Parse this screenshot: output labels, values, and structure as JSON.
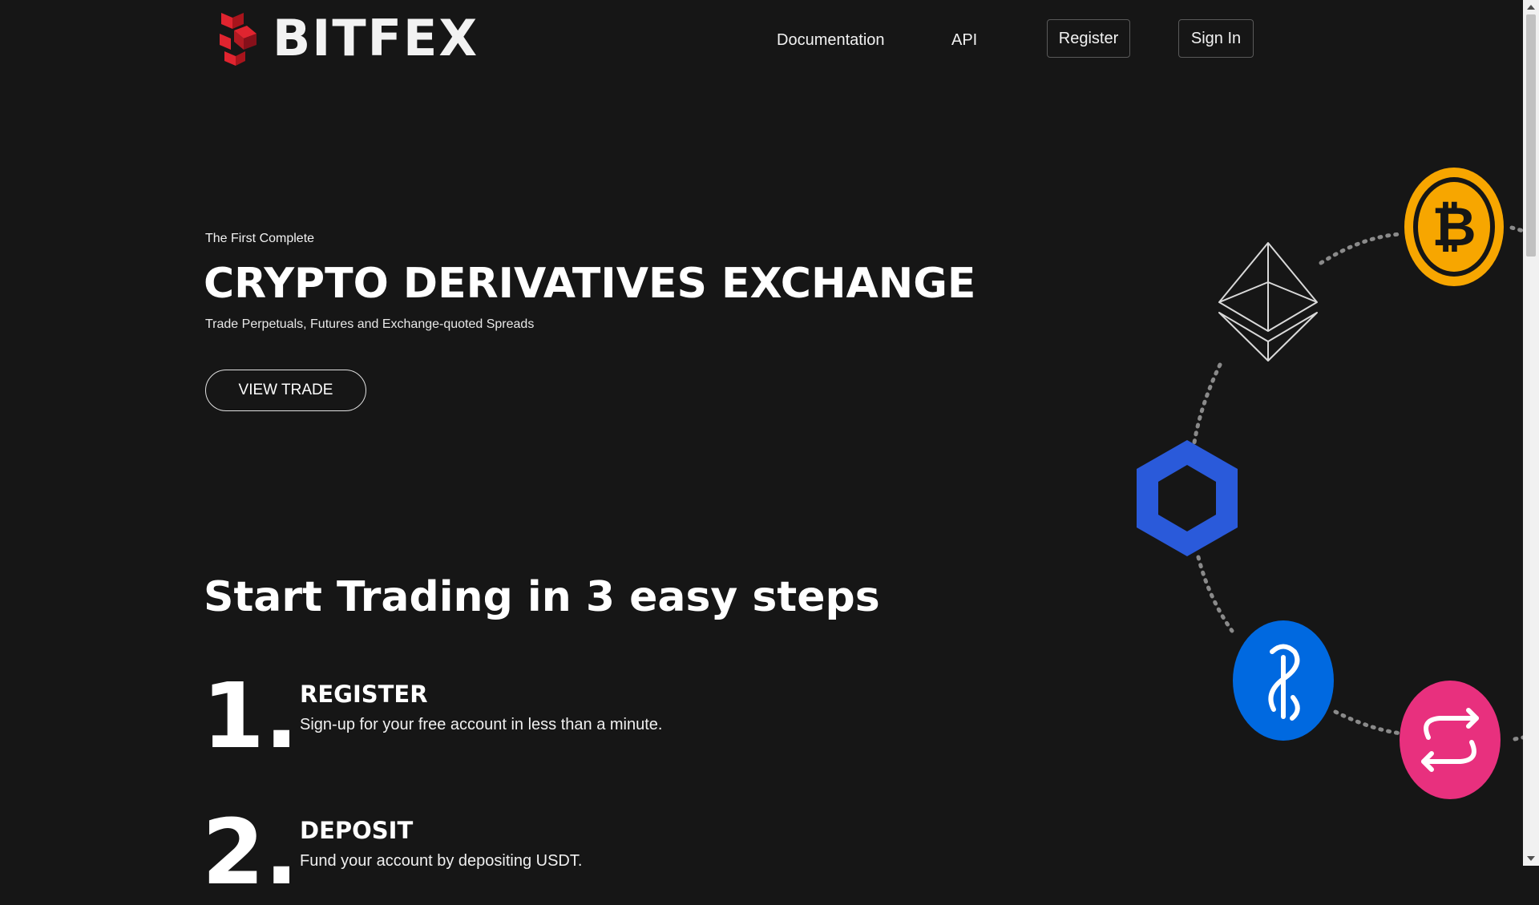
{
  "header": {
    "brand": "BITFEX",
    "nav": {
      "documentation": "Documentation",
      "api": "API",
      "register": "Register",
      "sign_in": "Sign In"
    }
  },
  "hero": {
    "eyebrow": "The First Complete",
    "title": "CRYPTO DERIVATIVES EXCHANGE",
    "subtitle": "Trade Perpetuals, Futures and Exchange-quoted Spreads",
    "cta": "VIEW TRADE"
  },
  "steps": {
    "title": "Start Trading in 3 easy steps",
    "items": [
      {
        "number": "1.",
        "title": "REGISTER",
        "desc": "Sign-up for your free account in less than a minute."
      },
      {
        "number": "2.",
        "title": "DEPOSIT",
        "desc": "Fund your account by depositing USDT."
      }
    ]
  },
  "coins": [
    {
      "icon": "bitcoin-icon",
      "color": "#F7A600"
    },
    {
      "icon": "ethereum-icon",
      "color": "#D9D9D9"
    },
    {
      "icon": "chainlink-icon",
      "color": "#2A5ADA"
    },
    {
      "icon": "yearn-icon",
      "color": "#0069E0"
    },
    {
      "icon": "swap-icon",
      "color": "#E8307E"
    }
  ],
  "colors": {
    "background": "#161616",
    "brand_red": "#E0242F",
    "text": "#FFFFFF"
  }
}
